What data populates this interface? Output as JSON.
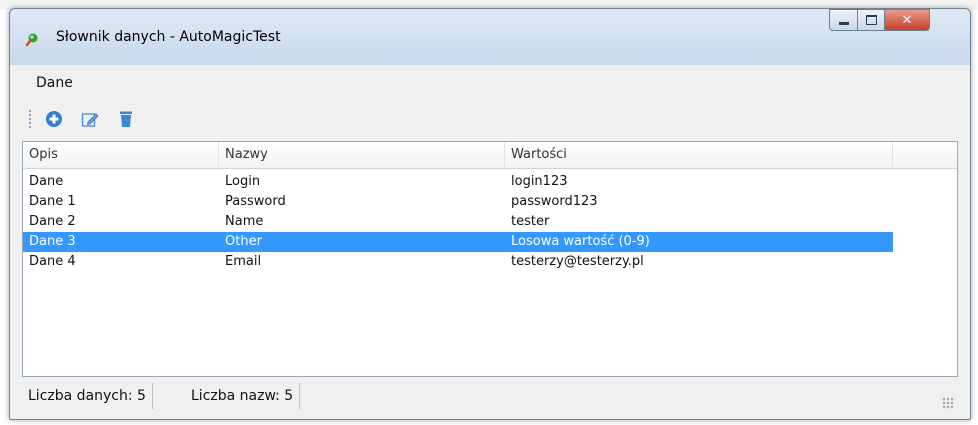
{
  "window": {
    "title": "Słownik danych - AutoMagicTest"
  },
  "menu": {
    "items": [
      "Dane"
    ]
  },
  "toolbar": {
    "buttons": [
      "add-icon",
      "edit-icon",
      "delete-icon"
    ]
  },
  "table": {
    "columns": [
      "Opis",
      "Nazwy",
      "Wartości"
    ],
    "rows": [
      {
        "opis": "Dane",
        "nazwa": "Login",
        "wartosc": "login123",
        "selected": false
      },
      {
        "opis": "Dane 1",
        "nazwa": "Password",
        "wartosc": "password123",
        "selected": false
      },
      {
        "opis": "Dane 2",
        "nazwa": "Name",
        "wartosc": "tester",
        "selected": false
      },
      {
        "opis": "Dane 3",
        "nazwa": "Other",
        "wartosc": "Losowa wartość (0-9)",
        "selected": true
      },
      {
        "opis": "Dane 4",
        "nazwa": "Email",
        "wartosc": "testerzy@testerzy.pl",
        "selected": false
      }
    ]
  },
  "status": {
    "data_count": "Liczba danych: 5",
    "name_count": "Liczba nazw: 5"
  },
  "colors": {
    "selection": "#3399ff",
    "titlebar": "#c6d8ec",
    "close": "#c5412b"
  }
}
